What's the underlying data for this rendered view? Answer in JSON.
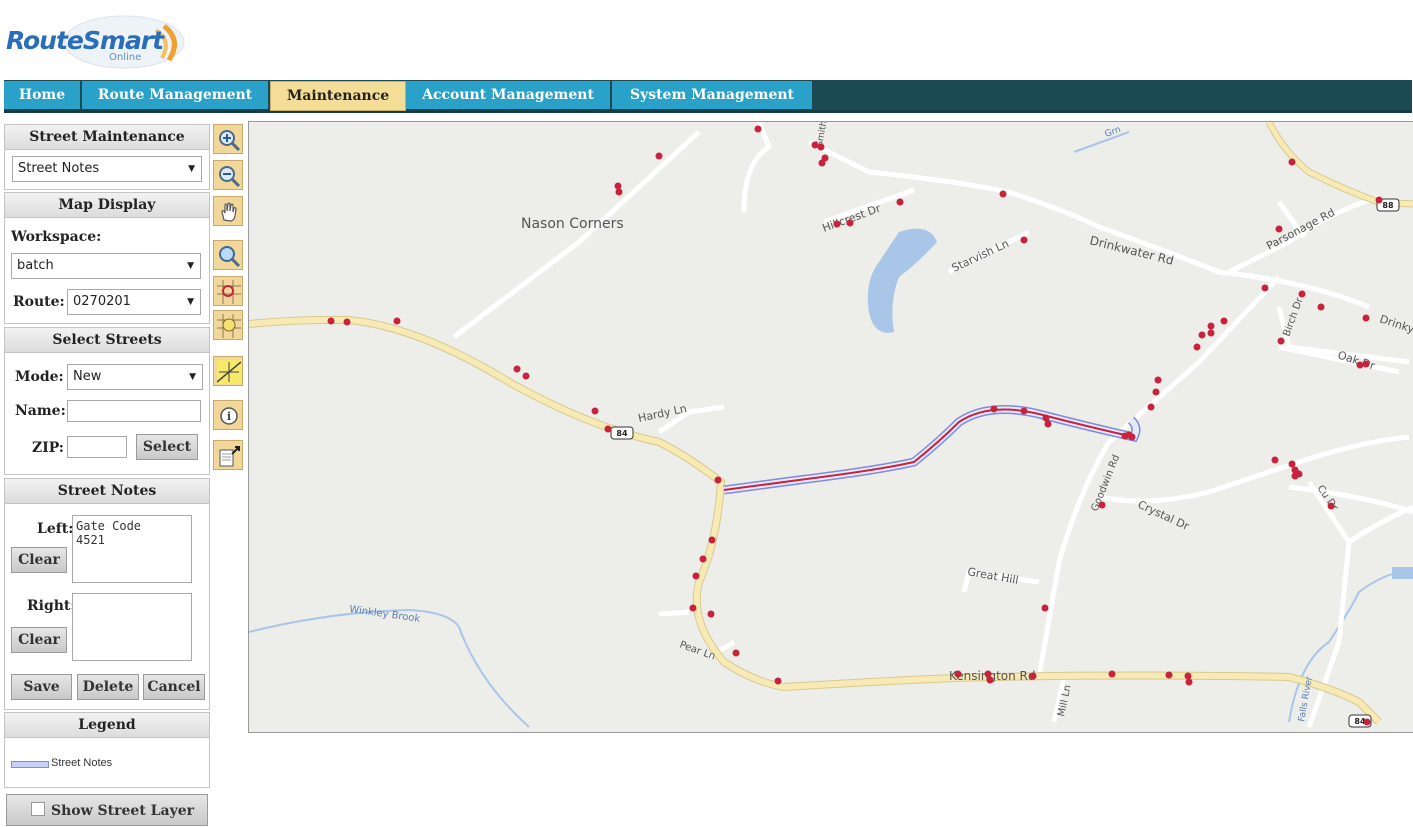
{
  "app": {
    "logo_text": "RouteSmart",
    "logo_sub": "Online"
  },
  "nav": {
    "tabs": [
      {
        "label": "Home",
        "active": false
      },
      {
        "label": "Route Management",
        "active": false
      },
      {
        "label": "Maintenance",
        "active": true
      },
      {
        "label": "Account Management",
        "active": false
      },
      {
        "label": "System Management",
        "active": false
      }
    ]
  },
  "street_maintenance": {
    "title": "Street Maintenance",
    "selected": "Street Notes"
  },
  "map_display": {
    "title": "Map Display",
    "workspace_label": "Workspace:",
    "workspace_value": "batch",
    "route_label": "Route:",
    "route_value": "0270201"
  },
  "select_streets": {
    "title": "Select Streets",
    "mode_label": "Mode:",
    "mode_value": "New",
    "name_label": "Name:",
    "name_value": "",
    "zip_label": "ZIP:",
    "zip_value": "",
    "select_button": "Select"
  },
  "street_notes": {
    "title": "Street Notes",
    "left_label": "Left:",
    "left_value": "Gate Code\n4521",
    "right_label": "Right:",
    "right_value": "",
    "clear_label": "Clear",
    "save_label": "Save",
    "delete_label": "Delete",
    "cancel_label": "Cancel"
  },
  "legend": {
    "title": "Legend",
    "item": "Street Notes",
    "item_color": "#7a8be0"
  },
  "show_street_layer": {
    "label": "Show Street Layer",
    "checked": false
  },
  "toolbar": {
    "tools": [
      "zoom-in-icon",
      "zoom-out-icon",
      "pan-hand-icon",
      "zoom-extent-icon",
      "select-area-icon",
      "select-point-icon",
      "select-line-icon",
      "info-icon",
      "report-icon"
    ]
  },
  "map": {
    "place_labels": [
      "Nason Corners",
      "Hillcrest Dr",
      "Starvish Ln",
      "Drinkwater Rd",
      "Parsonage Rd",
      "Drinky",
      "Birch Dr",
      "Oak Dr",
      "Hardy Ln",
      "Goodwin Rd",
      "Crystal Dr",
      "Cu Dr",
      "Great Hill",
      "Winkley Brook",
      "Pear Ln",
      "Kensington Rd",
      "Mill Ln",
      "Falls River",
      "Grn",
      "84",
      "88",
      "Smith"
    ],
    "colors": {
      "background": "#ededea",
      "road_major": "#f7eab5",
      "road_minor": "#ffffff",
      "water": "#a9c6e8",
      "stop_marker": "#c8233c",
      "note_highlight": "#7a8be0"
    }
  }
}
